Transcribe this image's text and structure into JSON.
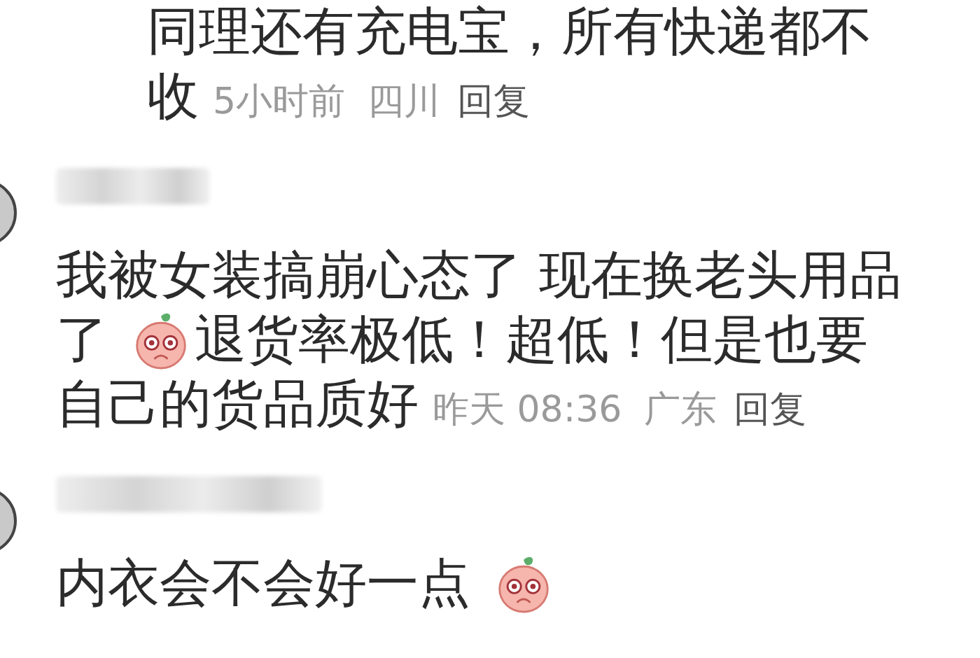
{
  "comments": [
    {
      "kind": "continued",
      "lines": [
        [
          {
            "kind": "text",
            "text": "同理还有充电宝，所有快递都不"
          }
        ],
        [
          {
            "kind": "text",
            "text": "收"
          }
        ]
      ],
      "time": "5小时前",
      "region": "四川",
      "reply": "回复"
    },
    {
      "kind": "full",
      "lines": [
        [
          {
            "kind": "text",
            "text": "我被女装搞崩心态了 现在换老头用品"
          }
        ],
        [
          {
            "kind": "text",
            "text": "了"
          },
          {
            "kind": "sticker"
          },
          {
            "kind": "text",
            "text": "退货率极低！超低！但是也要"
          }
        ],
        [
          {
            "kind": "text",
            "text": "自己的货品质好"
          }
        ]
      ],
      "time": "昨天 08:36",
      "region": "广东",
      "reply": "回复"
    },
    {
      "kind": "full",
      "lines": [
        [
          {
            "kind": "text",
            "text": "内衣会不会好一点"
          },
          {
            "kind": "sticker"
          }
        ]
      ]
    }
  ]
}
